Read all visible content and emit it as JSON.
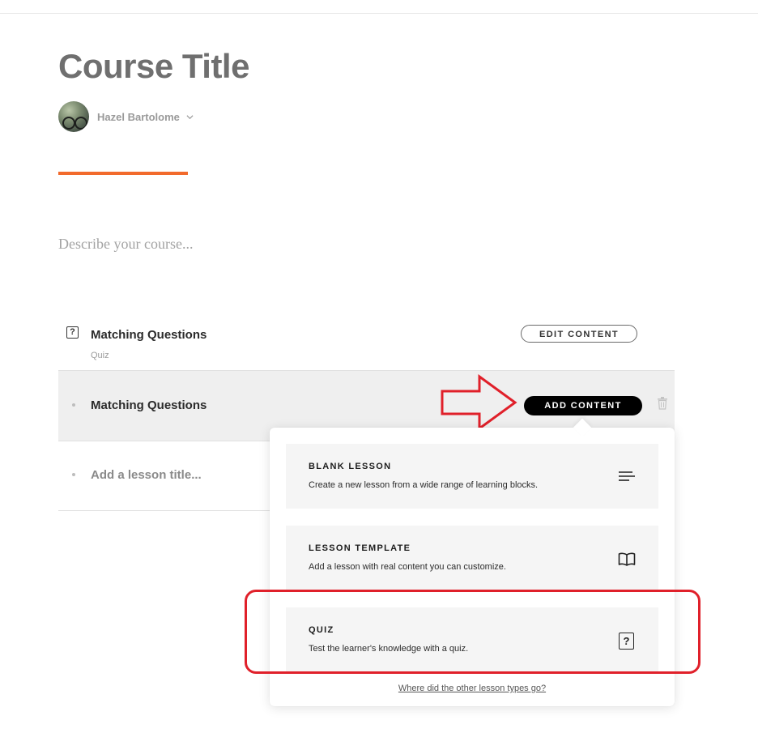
{
  "course": {
    "title": "Course Title",
    "author": "Hazel Bartolome",
    "description_placeholder": "Describe your course..."
  },
  "lessons": [
    {
      "title": "Matching Questions",
      "type": "Quiz",
      "button": "EDIT CONTENT",
      "icon": "quiz-icon"
    },
    {
      "title": "Matching Questions",
      "button": "ADD CONTENT",
      "icon": "trash-icon"
    },
    {
      "title_placeholder": "Add a lesson title..."
    }
  ],
  "dropdown": {
    "options": [
      {
        "title": "BLANK LESSON",
        "desc": "Create a new lesson from a wide range of learning blocks.",
        "icon": "text-lines-icon"
      },
      {
        "title": "LESSON TEMPLATE",
        "desc": "Add a lesson with real content you can customize.",
        "icon": "book-icon"
      },
      {
        "title": "QUIZ",
        "desc": "Test the learner's knowledge with a quiz.",
        "icon": "quiz-icon"
      }
    ],
    "link": "Where did the other lesson types go?"
  },
  "colors": {
    "accent": "#f26a2c",
    "annotation": "#e0202a",
    "button_dark": "#000000"
  }
}
